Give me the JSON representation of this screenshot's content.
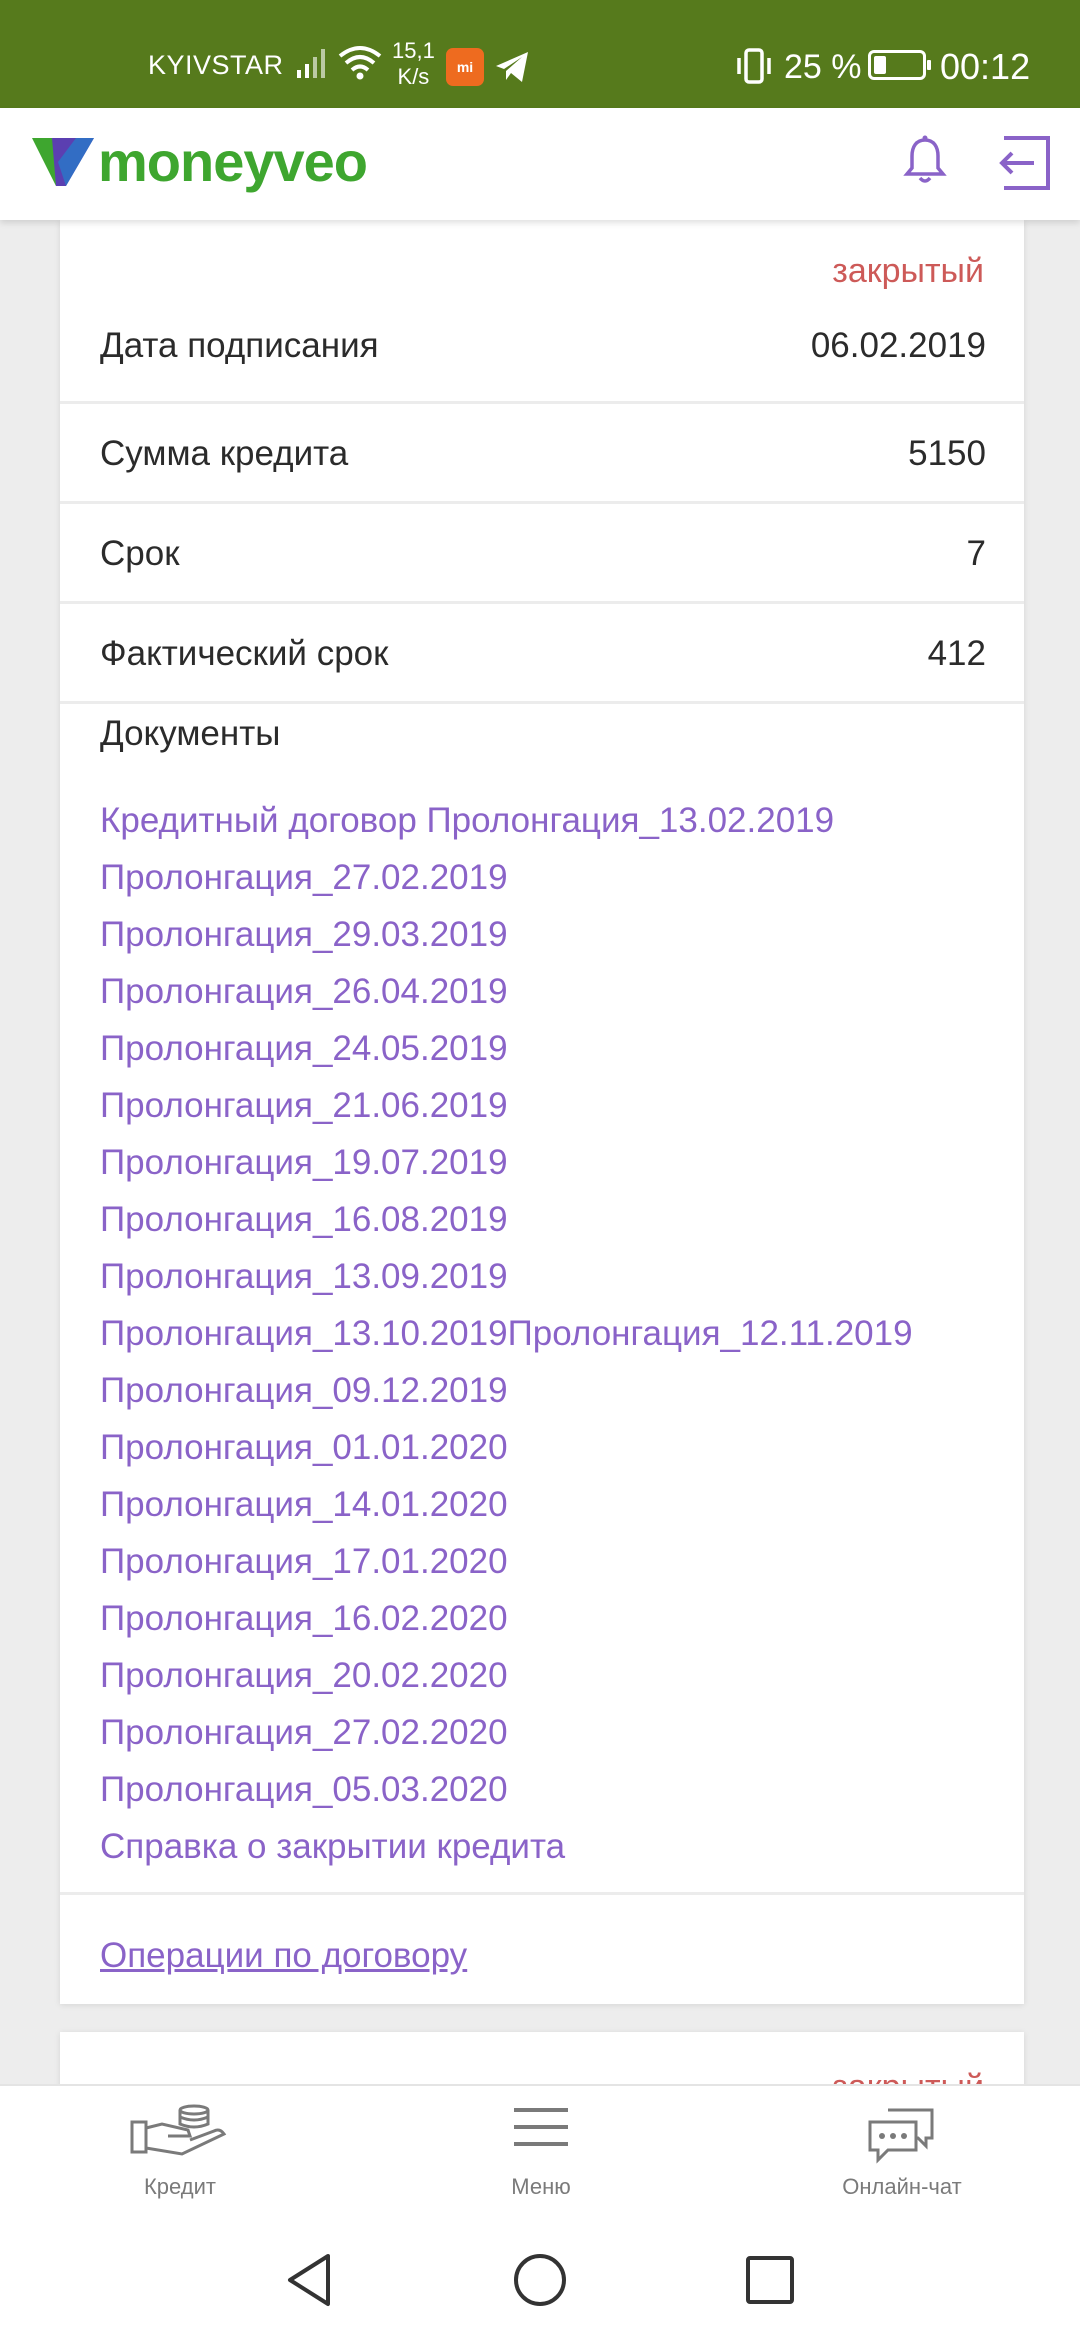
{
  "status_bar": {
    "carrier": "KYIVSTAR",
    "net_speed_value": "15,1",
    "net_speed_unit": "K/s",
    "battery_percent": "25 %",
    "battery_level": 0.25,
    "time": "00:12",
    "mi_icon_text": "mi"
  },
  "header": {
    "brand": "moneyveo",
    "colors": {
      "brand_green": "#3ea62f",
      "accent_purple": "#8a63c8"
    }
  },
  "contract": {
    "status": "закрытый",
    "fields": [
      {
        "label": "Дата подписания",
        "value": "06.02.2019"
      },
      {
        "label": "Сумма кредита",
        "value": "5150"
      },
      {
        "label": "Срок",
        "value": "7"
      },
      {
        "label": "Фактический срок",
        "value": "412"
      }
    ],
    "documents_title": "Документы",
    "documents": [
      "Кредитный договор Пролонгация_13.02.2019",
      "Пролонгация_27.02.2019",
      "Пролонгация_29.03.2019",
      "Пролонгация_26.04.2019",
      "Пролонгация_24.05.2019",
      "Пролонгация_21.06.2019",
      "Пролонгация_19.07.2019",
      "Пролонгация_16.08.2019",
      "Пролонгация_13.09.2019",
      "Пролонгация_13.10.2019Пролонгация_12.11.2019",
      "Пролонгация_09.12.2019",
      "Пролонгация_01.01.2020",
      "Пролонгация_14.01.2020",
      "Пролонгация_17.01.2020",
      "Пролонгация_16.02.2020",
      "Пролонгация_20.02.2020",
      "Пролонгация_27.02.2020",
      "Пролонгация_05.03.2020",
      "Справка о закрытии кредита"
    ],
    "operations_link": "Операции по договору"
  },
  "next_contract": {
    "status": "закрытый"
  },
  "bottom_nav": {
    "items": [
      {
        "label": "Кредит",
        "icon": "credit-hand-coins-icon"
      },
      {
        "label": "Меню",
        "icon": "hamburger-menu-icon"
      },
      {
        "label": "Онлайн-чат",
        "icon": "chat-bubbles-icon"
      }
    ]
  },
  "system_nav": {
    "icons": [
      "back-triangle-icon",
      "home-circle-icon",
      "recents-square-icon"
    ]
  }
}
